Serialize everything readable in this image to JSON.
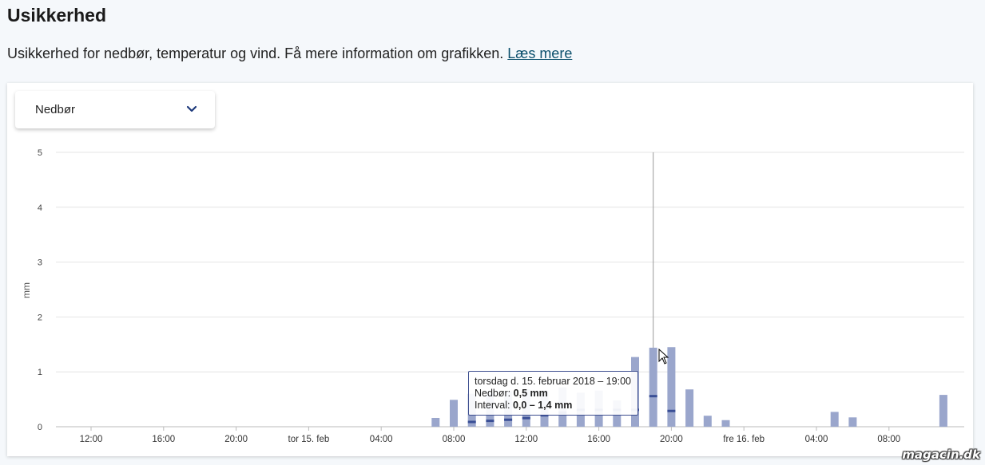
{
  "header": {
    "title": "Usikkerhed",
    "intro": "Usikkerhed for nedbør, temperatur og vind. Få mere information om grafikken.",
    "link": "Læs mere"
  },
  "dropdown": {
    "selected": "Nedbør",
    "icon": "chevron-down-icon"
  },
  "tooltip": {
    "date": "torsdag d. 15. februar 2018 – 19:00",
    "value_label": "Nedbør:",
    "value": "0,5 mm",
    "interval_label": "Interval:",
    "interval": "0,0 – 1,4 mm"
  },
  "watermark": "magacin.dk",
  "colors": {
    "bar": "#9aa6cc",
    "median": "#3a4f96",
    "link": "#0b4f6c",
    "tooltip_border": "#3c4d8e"
  },
  "chart_data": {
    "type": "bar",
    "ylabel": "mm",
    "ylim": [
      0,
      5
    ],
    "yticks": [
      0,
      1,
      2,
      3,
      4,
      5
    ],
    "xlim": [
      9,
      72
    ],
    "xticks": [
      {
        "label": "12:00",
        "x": 12
      },
      {
        "label": "16:00",
        "x": 16
      },
      {
        "label": "20:00",
        "x": 20
      },
      {
        "label": "tor 15. feb",
        "x": 24
      },
      {
        "label": "04:00",
        "x": 28
      },
      {
        "label": "08:00",
        "x": 32
      },
      {
        "label": "12:00",
        "x": 36
      },
      {
        "label": "16:00",
        "x": 40
      },
      {
        "label": "20:00",
        "x": 44
      },
      {
        "label": "fre 16. feb",
        "x": 48
      },
      {
        "label": "04:00",
        "x": 52
      },
      {
        "label": "08:00",
        "x": 56
      }
    ],
    "x_unit": "hours from 14. feb 00:00",
    "grid": true,
    "series": [
      {
        "bars": [
          {
            "x": 31,
            "high": 0.16,
            "median": null
          },
          {
            "x": 32,
            "high": 0.49,
            "median": null
          },
          {
            "x": 33,
            "high": 0.6,
            "median": 0.08
          },
          {
            "x": 34,
            "high": 0.62,
            "median": 0.1
          },
          {
            "x": 35,
            "high": 0.65,
            "median": 0.12
          },
          {
            "x": 36,
            "high": 0.68,
            "median": 0.15
          },
          {
            "x": 37,
            "high": 0.66,
            "median": 0.2
          },
          {
            "x": 38,
            "high": 0.72,
            "median": 0.25
          },
          {
            "x": 39,
            "high": 0.62,
            "median": 0.3
          },
          {
            "x": 40,
            "high": 0.66,
            "median": 0.3
          },
          {
            "x": 41,
            "high": 0.48,
            "median": 0.3
          },
          {
            "x": 42,
            "high": 1.27,
            "median": 0.3
          },
          {
            "x": 43,
            "high": 1.44,
            "median": 0.55
          },
          {
            "x": 44,
            "high": 1.45,
            "median": 0.28
          },
          {
            "x": 45,
            "high": 0.68,
            "median": null
          },
          {
            "x": 46,
            "high": 0.2,
            "median": null
          },
          {
            "x": 47,
            "high": 0.12,
            "median": null
          },
          {
            "x": 53,
            "high": 0.27,
            "median": null
          },
          {
            "x": 54,
            "high": 0.17,
            "median": null
          },
          {
            "x": 59,
            "high": 0.58,
            "median": null
          }
        ]
      }
    ],
    "crosshair_x": 43
  }
}
